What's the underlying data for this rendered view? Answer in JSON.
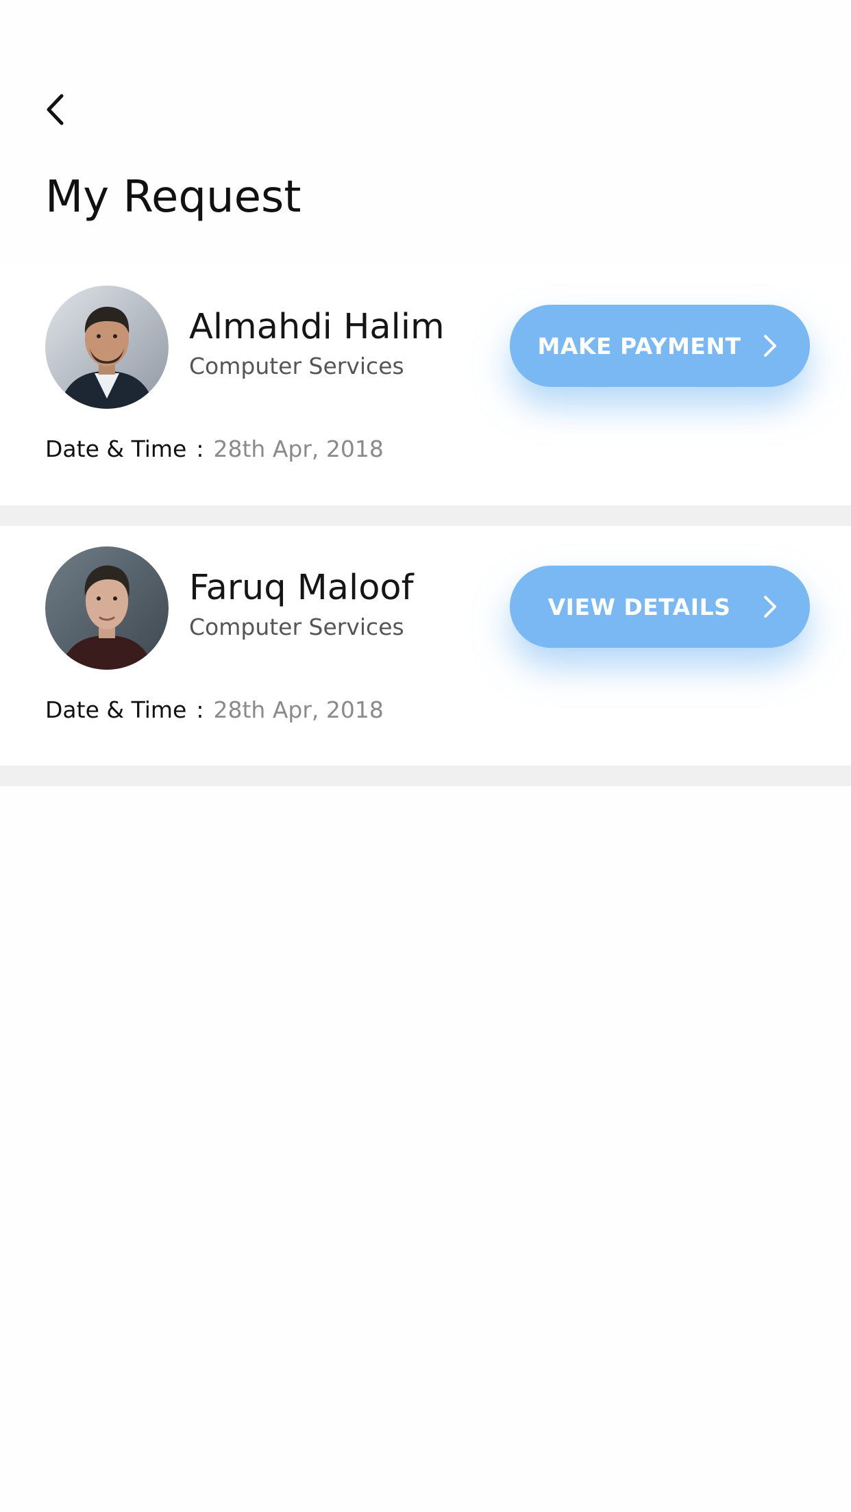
{
  "header": {
    "back_icon": "chevron-left-icon",
    "title": "My Request"
  },
  "requests": [
    {
      "name": "Almahdi Halim",
      "service": "Computer Services",
      "datetime_label": "Date & Time",
      "datetime_separator": ":",
      "datetime_value": "28th Apr, 2018",
      "action_label": "MAKE PAYMENT",
      "action_icon": "chevron-right-icon"
    },
    {
      "name": "Faruq Maloof",
      "service": "Computer Services",
      "datetime_label": "Date & Time",
      "datetime_separator": ":",
      "datetime_value": "28th Apr, 2018",
      "action_label": "VIEW DETAILS",
      "action_icon": "chevron-right-icon"
    }
  ],
  "colors": {
    "accent": "#79b8f2",
    "divider": "#f0f0f0",
    "muted_text": "#8a8a8a"
  }
}
